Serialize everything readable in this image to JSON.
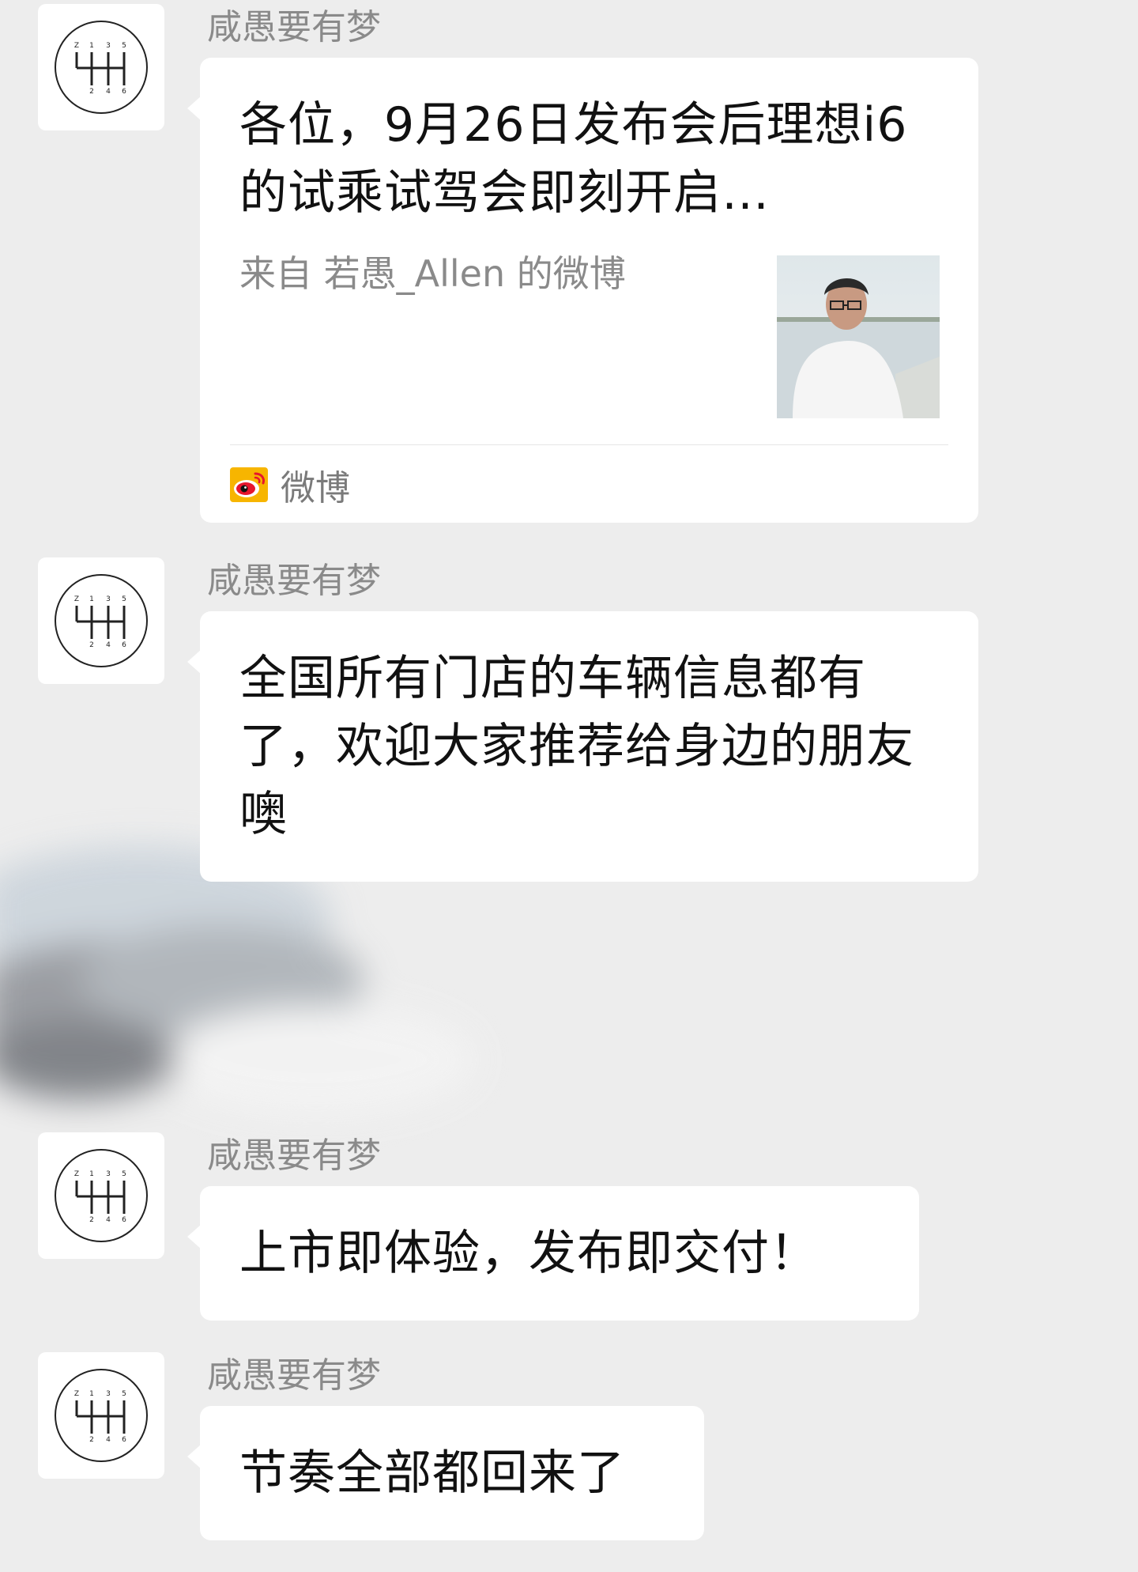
{
  "messages": [
    {
      "sender": "咸愚要有梦",
      "type": "link_card",
      "card": {
        "title": "各位，9月26日发布会后理想i6的试乘试驾会即刻开启…",
        "description": "来自 若愚_Allen 的微博",
        "source_label": "微博"
      }
    },
    {
      "sender": "咸愚要有梦",
      "type": "text",
      "text": "全国所有门店的车辆信息都有了，欢迎大家推荐给身边的朋友噢"
    },
    {
      "sender": "咸愚要有梦",
      "type": "text",
      "text": "上市即体验，发布即交付！"
    },
    {
      "sender": "咸愚要有梦",
      "type": "text",
      "text": "节奏全部都回来了"
    }
  ],
  "avatar": {
    "icon": "gear-shift-pattern-icon",
    "digits_top": [
      "Z",
      "1",
      "3",
      "5"
    ],
    "digits_bottom": [
      "2",
      "4",
      "6"
    ]
  },
  "colors": {
    "background": "#ededed",
    "bubble": "#ffffff",
    "sender_name": "#8a8a8a",
    "text": "#111111",
    "weibo_red": "#e6162d",
    "weibo_yellow": "#f7b500"
  }
}
